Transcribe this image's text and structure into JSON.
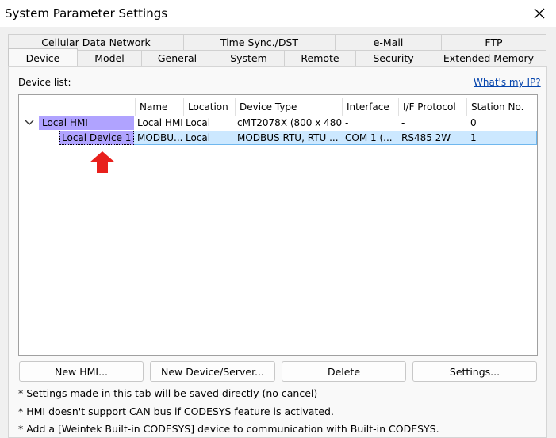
{
  "window": {
    "title": "System Parameter Settings"
  },
  "tabs_row1": [
    "Cellular Data Network",
    "Time Sync./DST",
    "e-Mail",
    "FTP"
  ],
  "tabs_row2": [
    "Device",
    "Model",
    "General",
    "System",
    "Remote",
    "Security",
    "Extended Memory"
  ],
  "active_tab": "Device",
  "device_list": {
    "label": "Device list:",
    "whats_my_ip": "What's my IP?",
    "columns": [
      "Name",
      "Location",
      "Device Type",
      "Interface",
      "I/F Protocol",
      "Station No."
    ],
    "rows": [
      {
        "tree_label": "Local HMI",
        "name": "Local HMI",
        "location": "Local",
        "device_type": "cMT2078X (800 x 480)",
        "interface": "-",
        "protocol": "-",
        "station": "0"
      },
      {
        "tree_label": "Local Device 1",
        "name": "MODBU...",
        "location": "Local",
        "device_type": "MODBUS RTU, RTU ...",
        "interface": "COM 1 (...",
        "protocol": "RS485 2W",
        "station": "1"
      }
    ]
  },
  "buttons": {
    "new_hmi": "New HMI...",
    "new_device": "New Device/Server...",
    "delete": "Delete",
    "settings": "Settings..."
  },
  "notes": [
    "* Settings made in this tab will be saved directly (no cancel)",
    "* HMI doesn't support CAN bus if CODESYS feature is activated.",
    "* Add a [Weintek Built-in CODESYS] device to communication with Built-in CODESYS."
  ],
  "colors": {
    "selection_highlight": "#b0a3ff",
    "row_selection": "#cce8ff",
    "link": "#0645ad",
    "arrow": "#e8201c"
  }
}
